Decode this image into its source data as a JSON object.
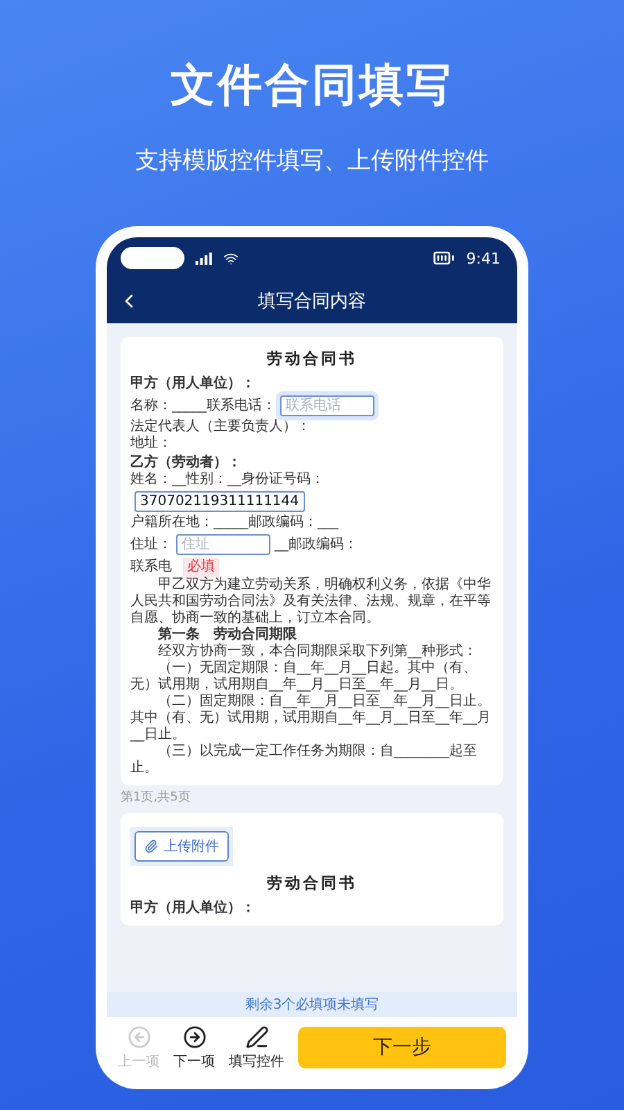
{
  "header": {
    "title": "文件合同填写",
    "subtitle": "支持模版控件填写、上传附件控件"
  },
  "status_bar": {
    "time": "9:41"
  },
  "nav": {
    "title": "填写合同内容"
  },
  "document": {
    "title": "劳动合同书",
    "lines": [
      {
        "kind": "label",
        "parts": [
          {
            "kind": "text",
            "text": "甲方（用人单位）："
          }
        ]
      },
      {
        "kind": "text",
        "parts": [
          {
            "kind": "text",
            "text": "名称：_____联系电话："
          },
          {
            "kind": "field",
            "placeholder": "联系电话",
            "focused": true
          }
        ]
      },
      {
        "kind": "text",
        "parts": [
          {
            "kind": "text",
            "text": "法定代表人（主要负责人）："
          }
        ]
      },
      {
        "kind": "text",
        "parts": [
          {
            "kind": "text",
            "text": "地址："
          }
        ]
      },
      {
        "kind": "label",
        "parts": [
          {
            "kind": "text",
            "text": "乙方（劳动者）："
          }
        ]
      },
      {
        "kind": "text",
        "parts": [
          {
            "kind": "text",
            "text": "姓名：__性别：__身份证号码："
          },
          {
            "kind": "field",
            "value": "370702119311111144",
            "focused": false
          }
        ]
      },
      {
        "kind": "text",
        "parts": [
          {
            "kind": "text",
            "text": "户籍所在地：_____邮政编码：___"
          }
        ]
      },
      {
        "kind": "text",
        "parts": [
          {
            "kind": "text",
            "text": "住址："
          },
          {
            "kind": "field",
            "placeholder": "住址",
            "focused": false
          },
          {
            "kind": "text",
            "text": "__邮政编码："
          }
        ]
      },
      {
        "kind": "text",
        "parts": [
          {
            "kind": "text",
            "text": "联系电"
          },
          {
            "kind": "tag",
            "text": "必填"
          }
        ]
      },
      {
        "kind": "para",
        "parts": [
          {
            "kind": "text",
            "text": "甲乙双方为建立劳动关系，明确权利义务，依据《中华人民共和国劳动合同法》及有关法律、法规、规章，在平等自愿、协商一致的基础上，订立本合同。"
          }
        ]
      },
      {
        "kind": "section",
        "parts": [
          {
            "kind": "text",
            "text": "第一条　劳动合同期限"
          }
        ]
      },
      {
        "kind": "para",
        "parts": [
          {
            "kind": "text",
            "text": "经双方协商一致，本合同期限采取下列第__种形式："
          }
        ]
      },
      {
        "kind": "para",
        "parts": [
          {
            "kind": "text",
            "text": "（一）无固定期限：自__年__月__日起。其中（有、无）试用期，试用期自__年__月__日至__年__月__日。"
          }
        ]
      },
      {
        "kind": "para",
        "parts": [
          {
            "kind": "text",
            "text": "（二）固定期限：自__年__月__日至__年__月__日止。其中（有、无）试用期，试用期自__年__月__日至__年__月__日止。"
          }
        ]
      },
      {
        "kind": "para",
        "parts": [
          {
            "kind": "text",
            "text": "（三）以完成一定工作任务为期限：自________起至止。"
          }
        ]
      }
    ]
  },
  "page_label": "第1页,共5页",
  "second_page": {
    "upload": "上传附件",
    "title": "劳动合同书",
    "line": "甲方（用人单位）："
  },
  "banner": "剩余3个必填项未填写",
  "toolbar": {
    "items": [
      {
        "label": "上一项",
        "disabled": true
      },
      {
        "label": "下一项",
        "disabled": false
      },
      {
        "label": "填写控件",
        "disabled": false
      }
    ],
    "primary": "下一步"
  }
}
